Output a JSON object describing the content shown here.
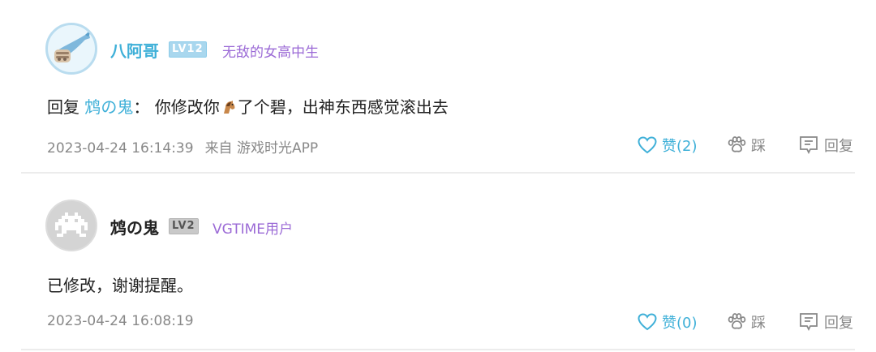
{
  "comments": [
    {
      "username": "八阿哥",
      "level": "LV12",
      "user_title": "无敌的女高中生",
      "reply_prefix": "回复",
      "reply_to": "鸩の鬼",
      "reply_colon": "：",
      "text_part1": "你修改你",
      "text_part2": "了个碧，出神东西感觉滚出去",
      "timestamp": "2023-04-24 16:14:39",
      "source": "来自 游戏时光APP",
      "like_label": "赞(2)",
      "tread_label": "踩",
      "reply_label": "回复"
    },
    {
      "username": "鸩の鬼",
      "level": "LV2",
      "user_title": "VGTIME用户",
      "text": "已修改，谢谢提醒。",
      "timestamp": "2023-04-24 16:08:19",
      "like_label": "赞(0)",
      "tread_label": "踩",
      "reply_label": "回复"
    }
  ],
  "colors": {
    "accent": "#3fb0d8",
    "title_purple": "#9b6ad6",
    "meta_gray": "#888888"
  }
}
